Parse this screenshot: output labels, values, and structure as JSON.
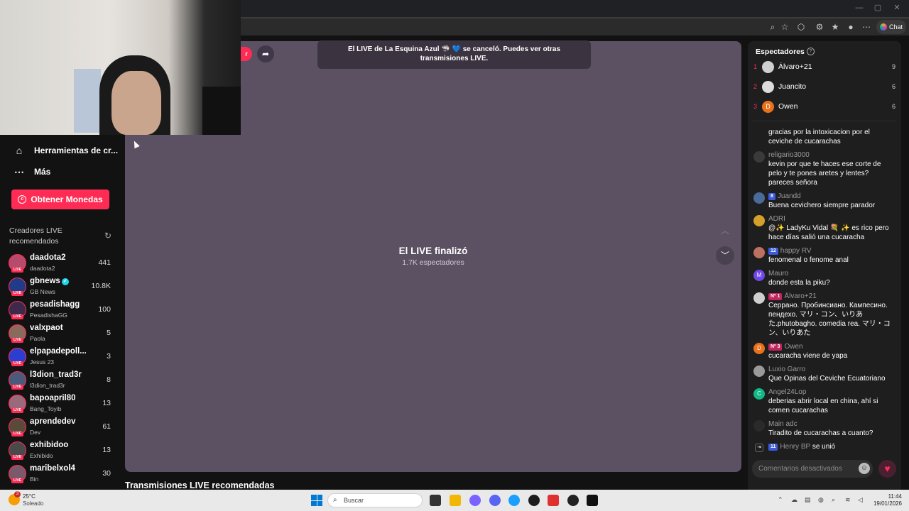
{
  "browser": {
    "chat_button_label": "Chat"
  },
  "sidebar": {
    "nav": [
      {
        "label": "Herramientas de cr...",
        "icon": "home-icon"
      },
      {
        "label": "Más",
        "icon": "more-icon"
      }
    ],
    "coins_button": "Obtener Monedas",
    "creators_title": "Creadores LIVE recomendados",
    "creators": [
      {
        "name": "daadota2",
        "sub": "daadota2",
        "count": "441",
        "color": "#b84a6b"
      },
      {
        "name": "gbnews",
        "sub": "GB News",
        "count": "10.8K",
        "color": "#1f3c88",
        "verified": true
      },
      {
        "name": "pesadishagg",
        "sub": "PesadishaGG",
        "count": "100",
        "color": "#3d2a4a"
      },
      {
        "name": "valxpaot",
        "sub": "Paola",
        "count": "5",
        "color": "#8a6a5a"
      },
      {
        "name": "elpapadepoll...",
        "sub": "Jesus 23",
        "count": "3",
        "color": "#2a3fd1"
      },
      {
        "name": "l3dion_trad3r",
        "sub": "l3dion_trad3r",
        "count": "8",
        "color": "#4b5a7a"
      },
      {
        "name": "bapoapril80",
        "sub": "Bang_Toyib",
        "count": "13",
        "color": "#9a6a7a"
      },
      {
        "name": "aprendedev",
        "sub": "Dev",
        "count": "61",
        "color": "#5a4a3a"
      },
      {
        "name": "exhibidoo",
        "sub": "Exhibido",
        "count": "13",
        "color": "#4a4a4a"
      },
      {
        "name": "maribelxol4",
        "sub": "Bin",
        "count": "30",
        "color": "#7a5a6a"
      }
    ]
  },
  "player": {
    "toast": "El LIVE de La Esquina Azul 🦈 💙 se canceló. Puedes ver otras transmisiones LIVE.",
    "ended_title": "El LIVE finalizó",
    "ended_viewers": "1.7K espectadores",
    "recommended_title": "Transmisiones LIVE recomendadas"
  },
  "chat": {
    "viewers_title": "Espectadores",
    "top_viewers": [
      {
        "rank": "1",
        "name": "Álvaro+21",
        "score": "9",
        "avatar_color": "#cfcfcf",
        "initial": ""
      },
      {
        "rank": "2",
        "name": "Juancito",
        "score": "6",
        "avatar_color": "#dcdcdc",
        "initial": ""
      },
      {
        "rank": "3",
        "name": "Owen",
        "score": "6",
        "avatar_color": "#e8711a",
        "initial": "D"
      }
    ],
    "messages": [
      {
        "user": "",
        "text": "gracias por la intoxicacion por el ceviche de cucarachas",
        "avatar_color": "#1e1e1e",
        "initial": ""
      },
      {
        "user": "religario3000",
        "text": "kevin por que te haces ese corte de pelo y te pones aretes y lentes? pareces señora",
        "avatar_color": "#3a3a3a",
        "initial": ""
      },
      {
        "user": "Juandd",
        "badge": "8",
        "badge_type": "blue",
        "text": "Buena cevichero siempre parador",
        "avatar_color": "#4a6a9a",
        "initial": ""
      },
      {
        "user": "ADRI",
        "text": "@✨ LadyKu Vidal 💐 ✨ es rico pero hace días salió una cucaracha",
        "avatar_color": "#d4a02a",
        "initial": ""
      },
      {
        "user": "happy RV",
        "badge": "12",
        "badge_type": "blue",
        "text": "fenomenal o fenome anal",
        "avatar_color": "#c07060",
        "initial": ""
      },
      {
        "user": "Mauro",
        "text": "donde esta la piku?",
        "avatar_color": "#7048e8",
        "initial": "M"
      },
      {
        "user": "Álvaro+21",
        "badge": "Nº 1",
        "badge_type": "red",
        "text": "Серрано. Пробинсиано. Кампесино. пендехо. マリ・コン、いりあた.phutobagho. comedia rea. マリ・コン、いりあた",
        "avatar_color": "#cfcfcf",
        "initial": ""
      },
      {
        "user": "Owen",
        "badge": "Nº 3",
        "badge_type": "red",
        "text": "cucaracha viene de yapa",
        "avatar_color": "#e8711a",
        "initial": "D"
      },
      {
        "user": "Luxio Garro",
        "text": "Que Opinas del Ceviche Ecuatoriano",
        "avatar_color": "#9a9a9a",
        "initial": ""
      },
      {
        "user": "Angel24Lop",
        "text": "deberias abrir local en china, ahí si comen cucarachas",
        "avatar_color": "#12b886",
        "initial": "C"
      },
      {
        "user": "Main adc",
        "text": "Tiradito de cucarachas a cuanto?",
        "avatar_color": "#2a2a2a",
        "initial": ""
      }
    ],
    "join_event": {
      "user": "Henry BP",
      "badge": "11",
      "text": "se unió"
    },
    "input_placeholder": "Comentarios desactivados"
  },
  "taskbar": {
    "weather_temp": "25°C",
    "weather_desc": "Soleado",
    "weather_badge": "3",
    "search_placeholder": "Buscar",
    "time": "11:44",
    "date": "19/01/2026"
  }
}
